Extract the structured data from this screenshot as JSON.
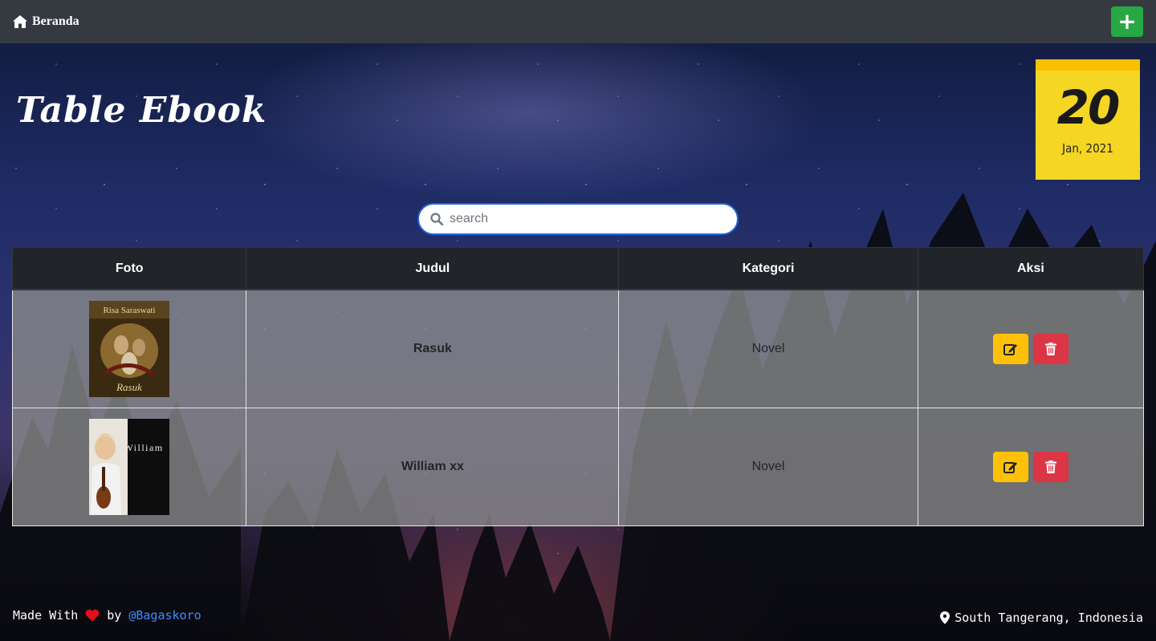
{
  "navbar": {
    "brand_label": "Beranda",
    "add_button_label": "+"
  },
  "page": {
    "title": "Table Ebook"
  },
  "calendar": {
    "day": "20",
    "month_year": "Jan, 2021"
  },
  "search": {
    "placeholder": "search"
  },
  "table": {
    "headers": [
      "Foto",
      "Judul",
      "Kategori",
      "Aksi"
    ],
    "rows": [
      {
        "cover_text": "Risa Saraswati",
        "cover_subtitle": "Rasuk",
        "title": "Rasuk",
        "category": "Novel"
      },
      {
        "cover_text": "William",
        "title": "William xx",
        "category": "Novel"
      }
    ]
  },
  "footer": {
    "made_with": "Made With",
    "by": "by",
    "author": "@Bagaskoro",
    "location": "South Tangerang, Indonesia"
  },
  "colors": {
    "navbar": "#343a40",
    "add_button": "#28a745",
    "edit_button": "#ffc107",
    "delete_button": "#dc3545",
    "calendar": "#f4d623",
    "link": "#3b8cff"
  }
}
